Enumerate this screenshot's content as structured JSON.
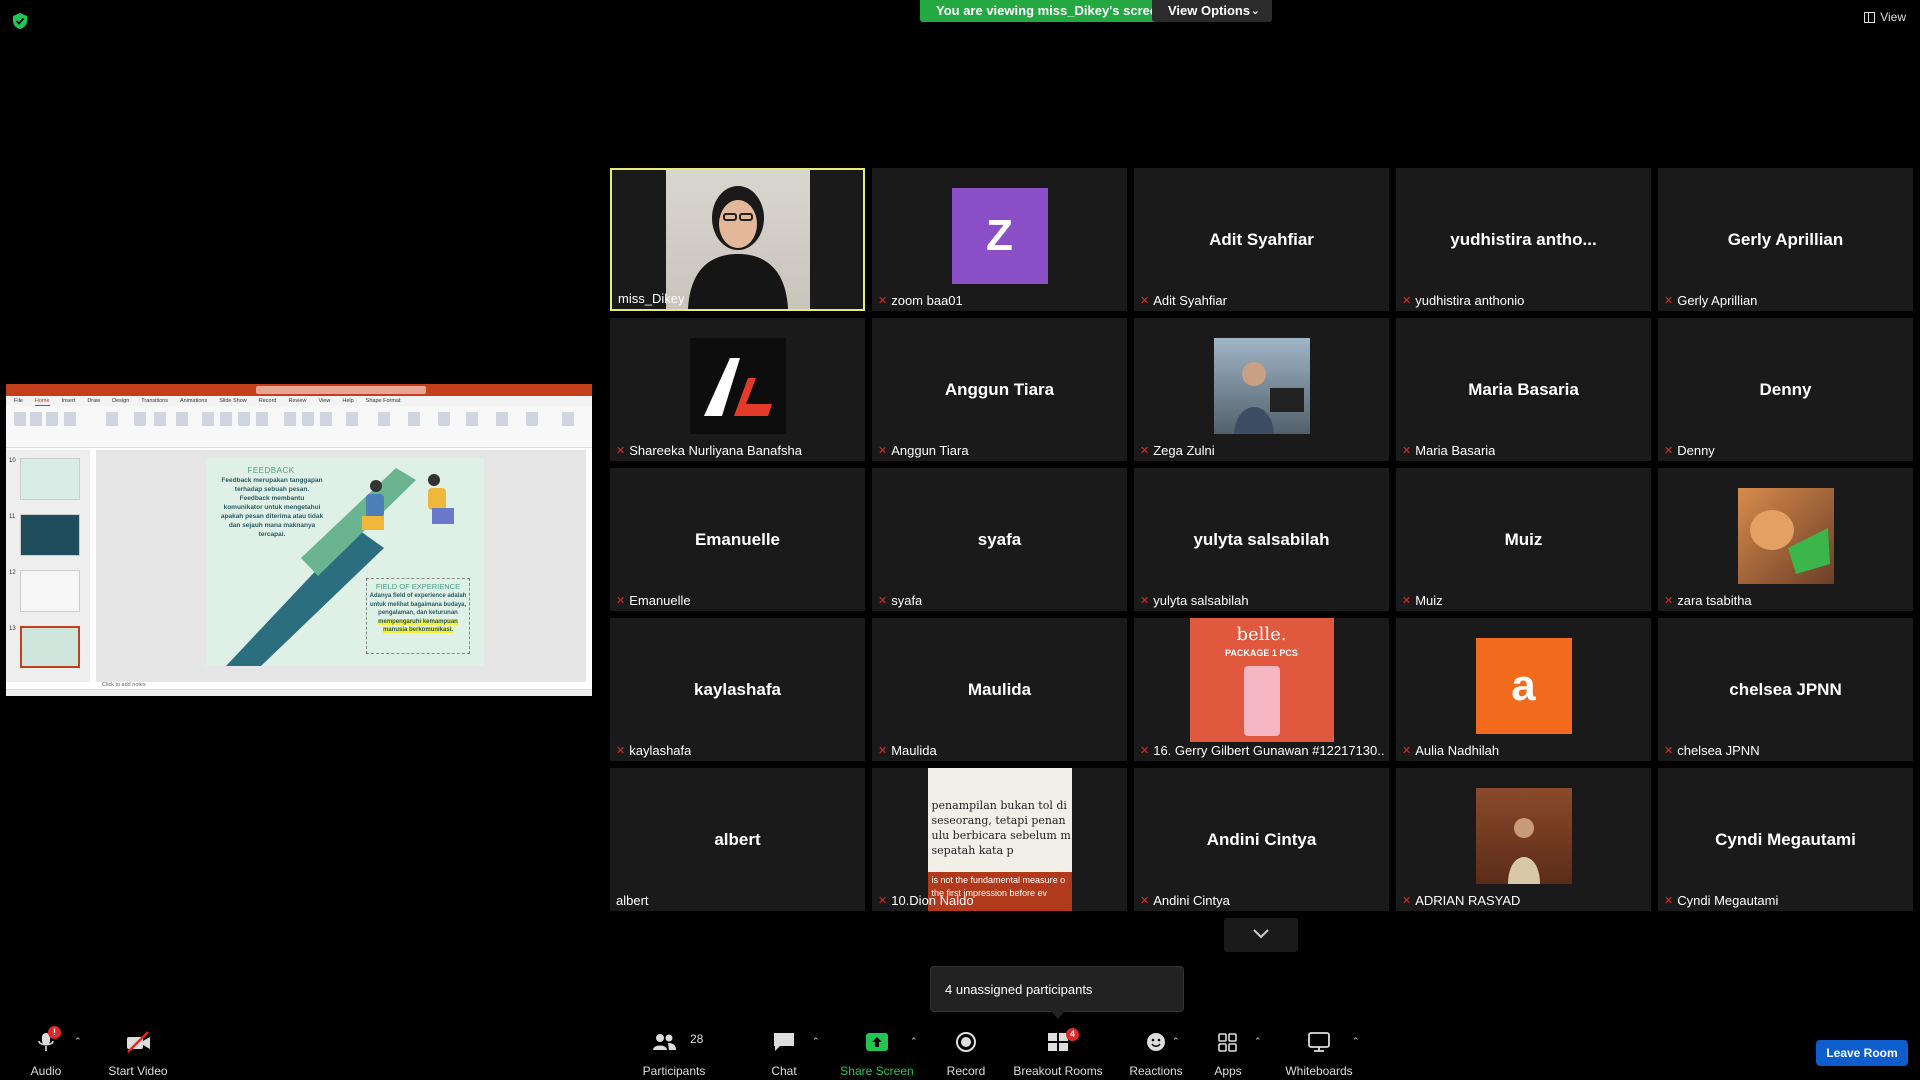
{
  "banner": {
    "viewing_text": "You are viewing miss_Dikey's screen",
    "view_options_label": "View Options",
    "view_label": "View",
    "accent": "#23a842"
  },
  "shared_screen": {
    "ppt_tabs": [
      "File",
      "Home",
      "Insert",
      "Draw",
      "Design",
      "Transitions",
      "Animations",
      "Slide Show",
      "Record",
      "Review",
      "View",
      "Help",
      "Shape Format"
    ],
    "thumb_numbers": [
      "10",
      "11",
      "12",
      "13"
    ],
    "slide": {
      "feedback_title": "FEEDBACK",
      "feedback_text": "Feedback merupakan tanggapan terhadap sebuah pesan. Feedback membantu komunikator untuk mengetahui apakah pesan diterima atau tidak dan sejauh mana maknanya tercapai.",
      "foe_title": "FIELD OF EXPERIENCE",
      "foe_text": "Adanya field of experience adalah untuk melihat bagaimana budaya, pengalaman, dan keturunan",
      "foe_highlight": "mempengaruhi kemampuan manusia berkomunikasi."
    },
    "notes_placeholder": "Click to add notes"
  },
  "gallery": {
    "tiles": [
      {
        "label": "miss_Dikey",
        "muted": false,
        "kind": "video",
        "active": true
      },
      {
        "label": "zoom baa01",
        "muted": true,
        "kind": "letter",
        "letter": "Z",
        "color": "#8a4fc7"
      },
      {
        "label": "Adit Syahfiar",
        "muted": true,
        "kind": "name",
        "big": "Adit Syahfiar"
      },
      {
        "label": "yudhistira anthonio",
        "muted": true,
        "kind": "name",
        "big": "yudhistira  antho..."
      },
      {
        "label": "Gerly Aprillian",
        "muted": true,
        "kind": "name",
        "big": "Gerly Aprillian"
      },
      {
        "label": "Shareeka Nurliyana Banafsha",
        "muted": true,
        "kind": "logo"
      },
      {
        "label": "Anggun Tiara",
        "muted": true,
        "kind": "name",
        "big": "Anggun Tiara"
      },
      {
        "label": "Zega Zulni",
        "muted": true,
        "kind": "photo-desk"
      },
      {
        "label": "Maria Basaria",
        "muted": true,
        "kind": "name",
        "big": "Maria Basaria"
      },
      {
        "label": "Denny",
        "muted": true,
        "kind": "name",
        "big": "Denny"
      },
      {
        "label": "Emanuelle",
        "muted": true,
        "kind": "name",
        "big": "Emanuelle"
      },
      {
        "label": "syafa",
        "muted": true,
        "kind": "name",
        "big": "syafa"
      },
      {
        "label": "yulyta salsabilah",
        "muted": true,
        "kind": "name",
        "big": "yulyta salsabilah"
      },
      {
        "label": "Muiz",
        "muted": true,
        "kind": "name",
        "big": "Muiz"
      },
      {
        "label": "zara tsabitha",
        "muted": true,
        "kind": "photo-cat"
      },
      {
        "label": "kaylashafa",
        "muted": true,
        "kind": "name",
        "big": "kaylashafa"
      },
      {
        "label": "Maulida",
        "muted": true,
        "kind": "name",
        "big": "Maulida"
      },
      {
        "label": "16. Gerry Gilbert Gunawan #12217130...",
        "muted": true,
        "kind": "photo-belle",
        "belle_title": "belle.",
        "belle_sub": "PACKAGE 1 PCS"
      },
      {
        "label": "Aulia Nadhilah",
        "muted": true,
        "kind": "letter",
        "letter": "a",
        "color": "#f26a1b"
      },
      {
        "label": "chelsea JPNN",
        "muted": true,
        "kind": "name",
        "big": "chelsea JPNN"
      },
      {
        "label": "albert",
        "muted": false,
        "kind": "name",
        "big": "albert"
      },
      {
        "label": "10.Dion Naldo",
        "muted": true,
        "kind": "photo-quote",
        "quote_top": "penampilan bukan tol di seseorang, tetapi penan ulu berbicara sebelum m sepatah kata p",
        "quote_bottom": "is not the fundamental measure o the first impression before ev"
      },
      {
        "label": "Andini Cintya",
        "muted": true,
        "kind": "name",
        "big": "Andini Cintya"
      },
      {
        "label": "ADRIAN RASYAD",
        "muted": true,
        "kind": "photo-person"
      },
      {
        "label": "Cyndi Megautami",
        "muted": true,
        "kind": "name",
        "big": "Cyndi Megautami"
      }
    ]
  },
  "unassigned_text": "4 unassigned participants",
  "toolbar": {
    "audio": "Audio",
    "audio_badge": "!",
    "start_video": "Start Video",
    "participants": "Participants",
    "participants_count": "28",
    "chat": "Chat",
    "share_screen": "Share Screen",
    "record": "Record",
    "breakout_rooms": "Breakout Rooms",
    "breakout_badge": "4",
    "reactions": "Reactions",
    "apps": "Apps",
    "whiteboards": "Whiteboards",
    "leave_room": "Leave Room"
  }
}
